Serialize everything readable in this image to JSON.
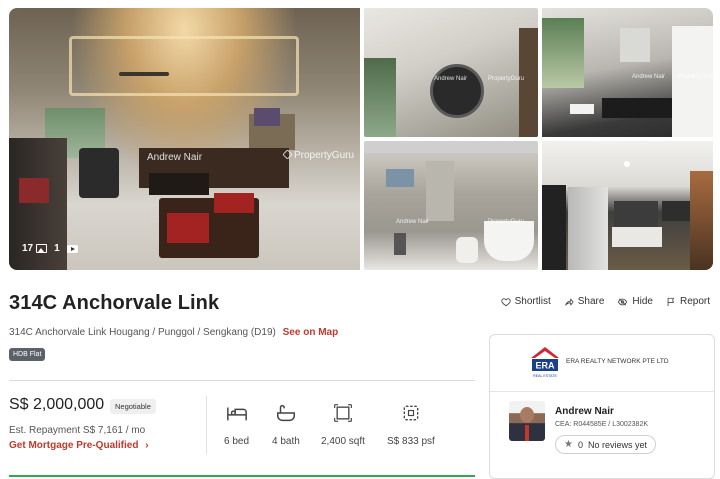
{
  "gallery": {
    "watermark_agent": "Andrew Nair",
    "watermark_brand": "PropertyGuru",
    "photo_count": "17",
    "video_count": "1"
  },
  "listing": {
    "title": "314C Anchorvale Link",
    "address": "314C Anchorvale Link Hougang / Punggol / Sengkang (D19)",
    "see_map": "See on Map",
    "property_type": "HDB Flat"
  },
  "actions": [
    {
      "label": "Shortlist",
      "icon": "heart-icon"
    },
    {
      "label": "Share",
      "icon": "share-icon"
    },
    {
      "label": "Hide",
      "icon": "hide-icon"
    },
    {
      "label": "Report",
      "icon": "flag-icon"
    }
  ],
  "price": {
    "amount": "S$ 2,000,000",
    "negotiable": "Negotiable",
    "repayment": "Est. Repayment S$ 7,161 / mo",
    "prequal": "Get Mortgage Pre-Qualified",
    "prequal_arrow": "›"
  },
  "specs": [
    {
      "label": "6 bed",
      "icon": "bed-icon"
    },
    {
      "label": "4 bath",
      "icon": "bath-icon"
    },
    {
      "label": "2,400 sqft",
      "icon": "area-icon"
    },
    {
      "label": "S$ 833 psf",
      "icon": "psf-icon"
    }
  ],
  "agent": {
    "agency": "ERA REALTY NETWORK PTE LTD",
    "logo_text": "ERA",
    "logo_sub": "REAL ESTATE",
    "name": "Andrew Nair",
    "cea": "CEA: R044585E / L3002382K",
    "review_count": "0",
    "review_text": "No reviews yet"
  },
  "colors": {
    "accent": "#c0392b",
    "badge": "#5b6168",
    "era_red": "#d22630",
    "era_blue": "#1b3f8b"
  }
}
